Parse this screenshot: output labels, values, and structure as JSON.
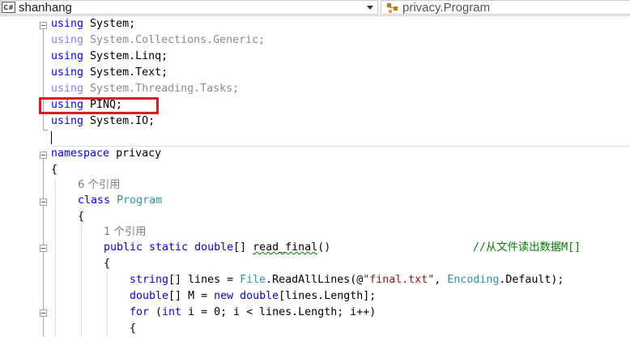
{
  "navbar": {
    "project_badge": "C#",
    "project_name": "shanhang",
    "class_name": "privacy.Program",
    "icon_project": "csharp-project-icon",
    "icon_class": "class-member-icon"
  },
  "code": {
    "using_1": {
      "kw": "using",
      "ns": " System;"
    },
    "using_2": {
      "kw": "using",
      "ns": " System.Collections.Generic;"
    },
    "using_3": {
      "kw": "using",
      "ns": " System.Linq;"
    },
    "using_4": {
      "kw": "using",
      "ns": " System.Text;"
    },
    "using_5": {
      "kw": "using",
      "ns": " System.Threading.Tasks;"
    },
    "using_6": {
      "kw": "using",
      "ns": " PINQ;"
    },
    "using_7": {
      "kw": "using",
      "ns": " System.IO;"
    },
    "namespace_kw": "namespace",
    "namespace_name": " privacy",
    "brace_open": "{",
    "refs_class": "6 个引用",
    "class_kw": "class",
    "class_name": "Program",
    "refs_method": "1 个引用",
    "method_mod": "public static double",
    "method_ret": "[] ",
    "method_name": "read_final",
    "method_parens": "()",
    "method_comment": "//从文件读出数据M[]",
    "l_lines_type": "string",
    "l_lines_mid": "[] lines = ",
    "l_lines_file": "File",
    "l_lines_call": ".ReadAllLines(@",
    "l_lines_str": "\"final.txt\"",
    "l_lines_comma": ", ",
    "l_lines_enc": "Encoding",
    "l_lines_end": ".Default);",
    "l_m_type": "double",
    "l_m_mid": "[] M = ",
    "l_m_new": "new",
    "l_m_type2": " double",
    "l_m_end": "[lines.Length];",
    "l_for_kw": "for",
    "l_for_open": " (",
    "l_for_int": "int",
    "l_for_rest": " i = 0; i < lines.Length; i++)",
    "brace_inner": "{"
  },
  "colors": {
    "keyword": "#0000ff",
    "type": "#2b91af",
    "string": "#a31515",
    "comment": "#008000",
    "highlight_box": "#e5191e"
  }
}
